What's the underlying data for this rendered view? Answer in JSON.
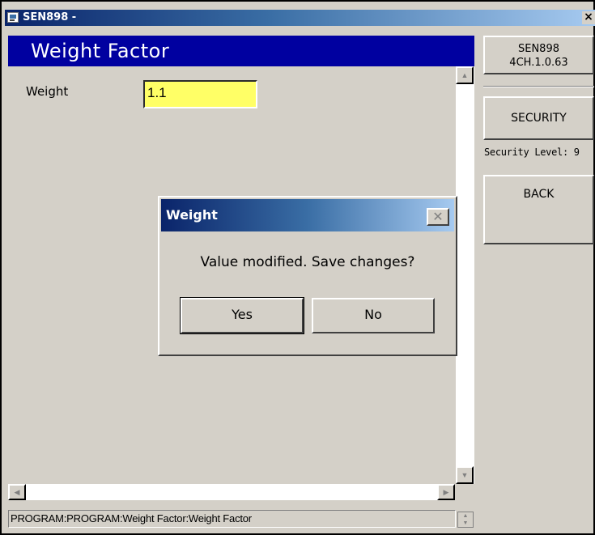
{
  "window": {
    "title": "SEN898 -",
    "close_glyph": "×"
  },
  "header": {
    "title": "Weight Factor"
  },
  "form": {
    "weight_label": "Weight",
    "weight_value": "1.1"
  },
  "status": {
    "text": "PROGRAM:PROGRAM:Weight Factor:Weight Factor"
  },
  "side": {
    "device_name": "SEN898",
    "device_version": "4CH.1.0.63",
    "security_button": "SECURITY",
    "security_level": "Security Level: 9",
    "back_button": "BACK"
  },
  "dialog": {
    "title": "Weight",
    "close_glyph": "✕",
    "message": "Value modified. Save changes?",
    "yes_label": "Yes",
    "no_label": "No"
  },
  "colors": {
    "header_bg": "#0000a0",
    "input_bg": "#ffff66",
    "face": "#d4d0c8"
  },
  "icons": {
    "app": "app-icon",
    "scroll_up": "scroll-up-arrow-icon",
    "scroll_down": "scroll-down-arrow-icon",
    "scroll_left": "scroll-left-arrow-icon",
    "scroll_right": "scroll-right-arrow-icon"
  }
}
